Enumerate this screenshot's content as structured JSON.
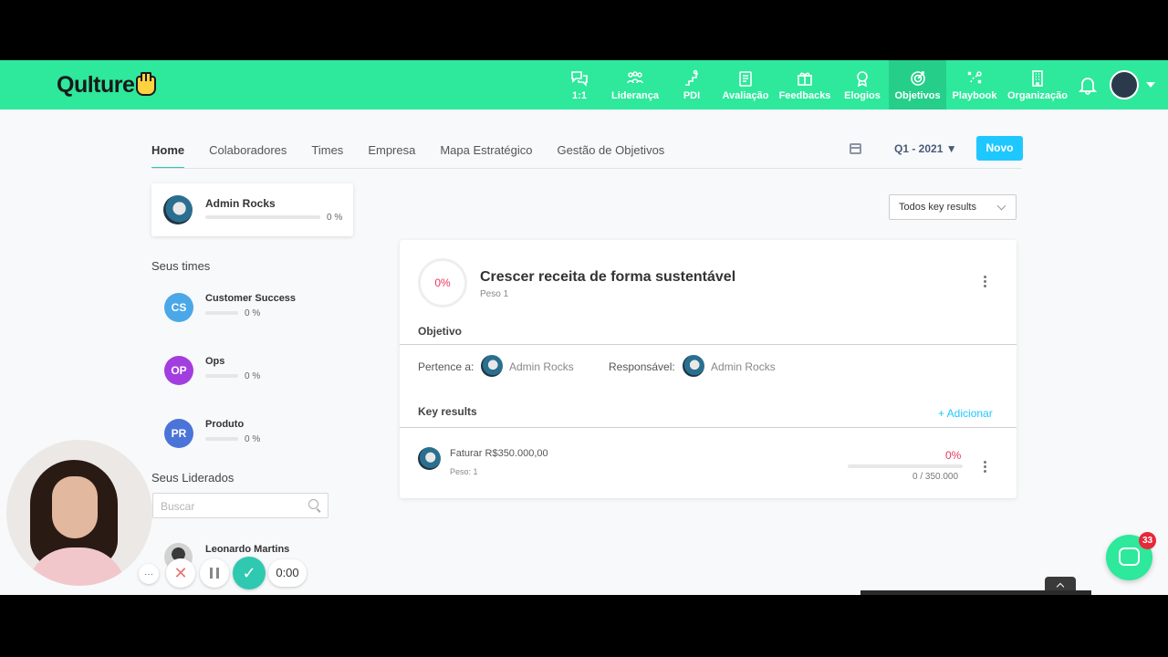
{
  "brand": {
    "name": "Qulture",
    "accent": "#2ee89c",
    "active_nav": "#25cf8a",
    "primary_button": "#1ec8ff",
    "danger": "#e8385a"
  },
  "nav": [
    {
      "label": "1:1",
      "icon": "chat-bubbles-icon"
    },
    {
      "label": "Liderança",
      "icon": "people-icon"
    },
    {
      "label": "PDI",
      "icon": "stairs-icon"
    },
    {
      "label": "Avaliação",
      "icon": "clipboard-icon"
    },
    {
      "label": "Feedbacks",
      "icon": "gift-icon"
    },
    {
      "label": "Elogios",
      "icon": "medal-icon"
    },
    {
      "label": "Objetivos",
      "icon": "target-icon",
      "active": true
    },
    {
      "label": "Playbook",
      "icon": "playbook-icon"
    },
    {
      "label": "Organização",
      "icon": "building-icon"
    }
  ],
  "subtabs": [
    "Home",
    "Colaboradores",
    "Times",
    "Empresa",
    "Mapa Estratégico",
    "Gestão de Objetivos"
  ],
  "period": "Q1 - 2021 ▼",
  "new_button": "Novo",
  "user": {
    "name": "Admin Rocks",
    "pct": "0 %",
    "progress": 0
  },
  "teams_title": "Seus times",
  "teams": [
    {
      "initials": "CS",
      "name": "Customer Success",
      "pct": "0 %",
      "color": "#4aa8e8",
      "progress": 0
    },
    {
      "initials": "OP",
      "name": "Ops",
      "pct": "0 %",
      "color": "#a23ee0",
      "progress": 0
    },
    {
      "initials": "PR",
      "name": "Produto",
      "pct": "0 %",
      "color": "#4a74d8",
      "progress": 0
    }
  ],
  "led_title": "Seus Liderados",
  "search_placeholder": "Buscar",
  "led_person": "Leonardo Martins",
  "filter": "Todos key results",
  "objective": {
    "pct": "0%",
    "title": "Crescer receita de forma sustentável",
    "peso": "Peso 1",
    "section_label": "Objetivo",
    "belongs_label": "Pertence a:",
    "belongs_name": "Admin Rocks",
    "resp_label": "Responsável:",
    "resp_name": "Admin Rocks",
    "kr_label": "Key results",
    "add_label": "+ Adicionar",
    "key_result": {
      "name": "Faturar R$350.000,00",
      "peso": "Peso: 1",
      "pct": "0%",
      "value": "0 / 350.000",
      "progress": 0
    }
  },
  "recording": {
    "time": "0:00",
    "more": "···"
  },
  "chat": {
    "badge": "33"
  }
}
